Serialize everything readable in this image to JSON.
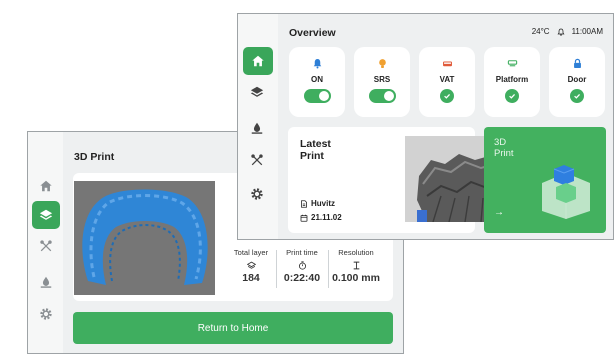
{
  "print_window": {
    "title": "3D Print",
    "stats": [
      {
        "label": "Total layer",
        "icon": "layers-icon",
        "value": "184"
      },
      {
        "label": "Print time",
        "icon": "timer-icon",
        "value": "0:22:40"
      },
      {
        "label": "Resolution",
        "icon": "resolution-icon",
        "value": "0.100 mm"
      }
    ],
    "home_button_label": "Return to Home",
    "sidebar": [
      "home-icon",
      "layers-icon",
      "tools-icon",
      "resin-drop-icon",
      "gear-icon"
    ],
    "active_sidebar_item": "layers-icon"
  },
  "overview_window": {
    "title": "Overview",
    "temperature": "24°C",
    "time": "11:00AM",
    "sidebar": [
      "home-icon",
      "layers-icon",
      "resin-drop-icon",
      "tools-icon",
      "gear-icon"
    ],
    "active_sidebar_item": "home-icon",
    "tiles": [
      {
        "label": "ON",
        "icon": "bell-icon",
        "icon_color": "#2e7fd6",
        "control": "toggle",
        "state": "on"
      },
      {
        "label": "SRS",
        "icon": "bulb-icon",
        "icon_color": "#f0a030",
        "control": "toggle",
        "state": "on"
      },
      {
        "label": "VAT",
        "icon": "vat-icon",
        "icon_color": "#e05a3a",
        "control": "check",
        "state": "ok"
      },
      {
        "label": "Platform",
        "icon": "platform-icon",
        "icon_color": "#3fae5f",
        "control": "check",
        "state": "ok"
      },
      {
        "label": "Door",
        "icon": "lock-icon",
        "icon_color": "#2e7fd6",
        "control": "check",
        "state": "ok"
      }
    ],
    "latest": {
      "title_line1": "Latest",
      "title_line2": "Print",
      "user": "Huvitz",
      "date": "21.11.02"
    },
    "start_card": {
      "line1": "3D",
      "line2": "Print",
      "arrow": "→"
    }
  },
  "colors": {
    "accent_green": "#3fae5f",
    "model_blue": "#2f86d6",
    "panel_bg": "#eef0f1"
  }
}
